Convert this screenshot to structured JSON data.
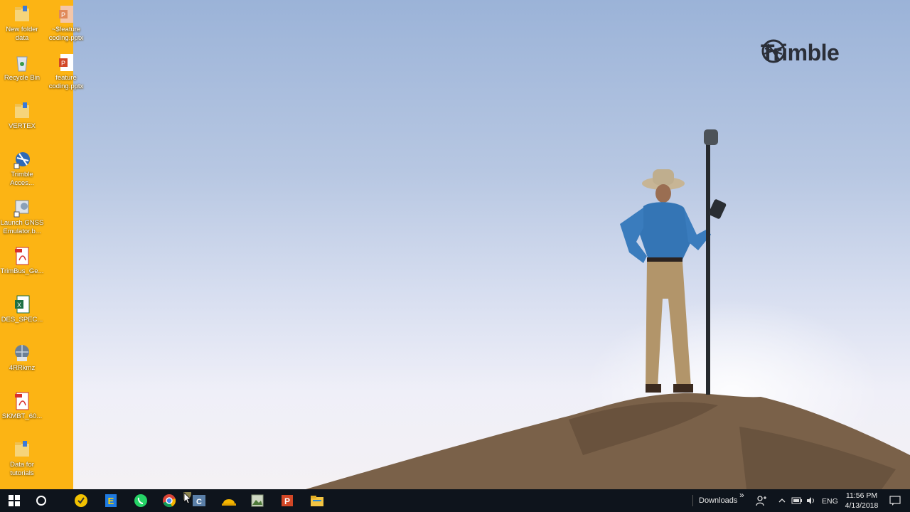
{
  "brand": {
    "name": "Trimble"
  },
  "desktop": {
    "icons": [
      {
        "label": "New folder data",
        "icon": "folder-icon"
      },
      {
        "label": "~$feature coding.pptx",
        "icon": "pptx-file-icon"
      },
      {
        "label": "Recycle Bin",
        "icon": "recycle-bin-icon"
      },
      {
        "label": "feature coding.pptx",
        "icon": "pptx-file-icon"
      },
      {
        "label": "VERTEX",
        "icon": "folder-icon"
      },
      {
        "label": "Trimble Acces...",
        "icon": "trimble-access-icon"
      },
      {
        "label": "Launch GNSS Emulator.b...",
        "icon": "shortcut-icon"
      },
      {
        "label": "TrimBus_Ge...",
        "icon": "pdf-file-icon"
      },
      {
        "label": "DES_SPEC...",
        "icon": "excel-file-icon"
      },
      {
        "label": "4RRkmz",
        "icon": "kmz-file-icon"
      },
      {
        "label": "SKMBT_60...",
        "icon": "pdf-file-icon"
      },
      {
        "label": "Data for tutorials",
        "icon": "folder-icon"
      }
    ]
  },
  "taskbar": {
    "pinned": [
      {
        "name": "start-button-icon"
      },
      {
        "name": "search-cortana-icon"
      },
      {
        "name": "norton-app-icon"
      },
      {
        "name": "edge-app-icon"
      },
      {
        "name": "whatsapp-app-icon"
      },
      {
        "name": "chrome-app-icon"
      },
      {
        "name": "business-center-app-icon"
      },
      {
        "name": "hardhat-app-icon"
      },
      {
        "name": "photos-app-icon"
      },
      {
        "name": "powerpoint-app-icon"
      },
      {
        "name": "file-explorer-app-icon"
      }
    ],
    "tray": {
      "downloads_label": "Downloads",
      "downloads_chevron": "»",
      "language": "ENG",
      "time": "11:56 PM",
      "date": "4/13/2018"
    }
  },
  "colors": {
    "strip": "#fcb414",
    "taskbar": "#0e141c"
  }
}
